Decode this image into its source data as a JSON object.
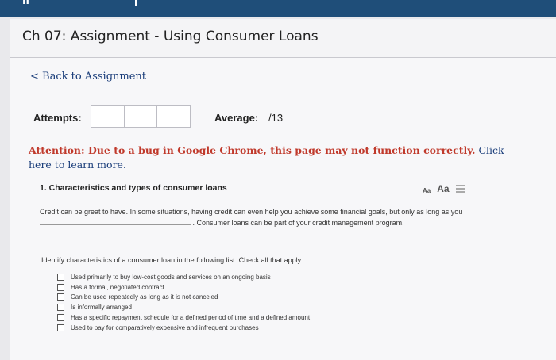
{
  "app": {
    "title": "Ch 07: Assignment - Using Consumer Loans"
  },
  "nav": {
    "back_label": "< Back to Assignment"
  },
  "stats": {
    "attempts_label": "Attempts:",
    "average_label": "Average:",
    "average_value": "/13"
  },
  "notice": {
    "warning": "Attention: Due to a bug in Google Chrome, this page may not function correctly.",
    "link": "Click here to learn more."
  },
  "question": {
    "title": "1. Characteristics and types of consumer loans",
    "font_small": "Aa",
    "font_large": "Aa",
    "passage_part1": "Credit can be great to have. In some situations, having credit can even help you achieve some financial goals, but only as long as you",
    "passage_part2": ". Consumer loans can be part of your credit management program.",
    "instruction": "Identify characteristics of a consumer loan in the following list. Check all that apply.",
    "options": [
      "Used primarily to buy low-cost goods and services on an ongoing basis",
      "Has a formal, negotiated contract",
      "Can be used repeatedly as long as it is not canceled",
      "Is informally arranged",
      "Has a specific repayment schedule for a defined period of time and a defined amount",
      "Used to pay for comparatively expensive and infrequent purchases"
    ]
  },
  "colors": {
    "header": "#1f4e79",
    "warning": "#c0392b",
    "link": "#1a3d7a"
  }
}
